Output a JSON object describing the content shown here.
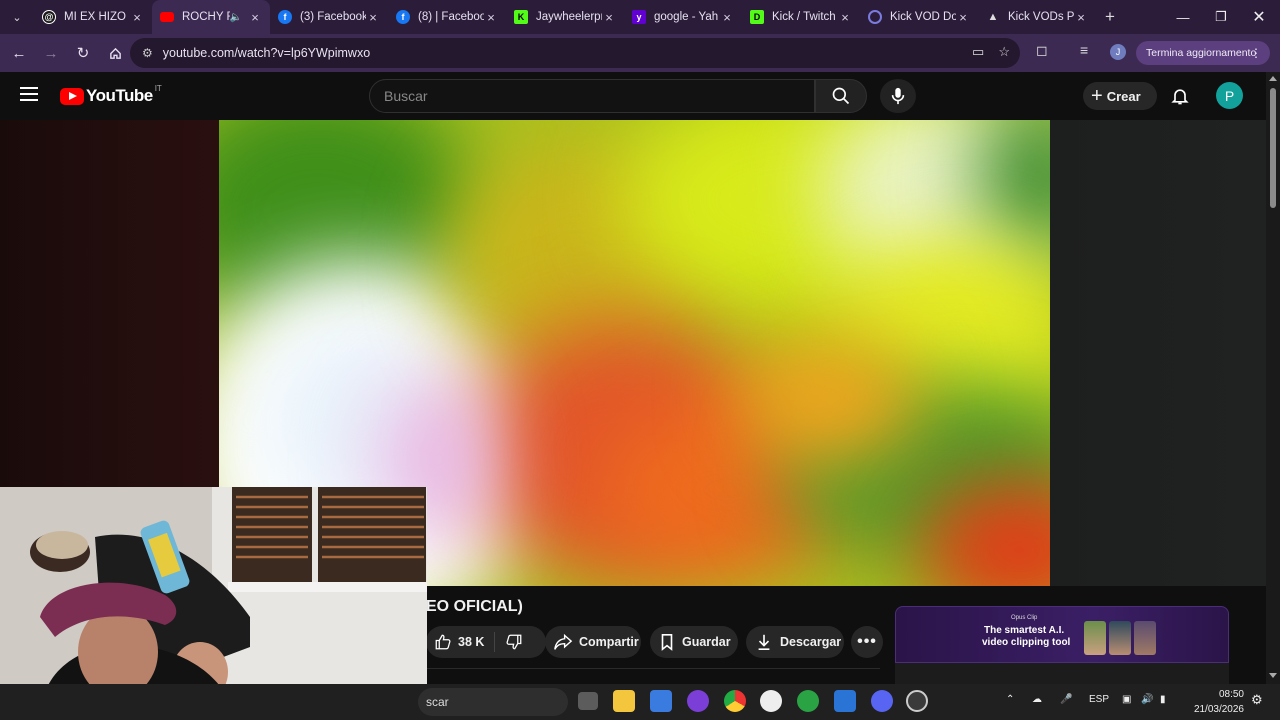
{
  "browser": {
    "tabs": [
      {
        "title": "MI EX HIZO",
        "icon": "threads-icon",
        "color": "#ffffff",
        "active": false
      },
      {
        "title": "ROCHY R",
        "icon": "youtube-icon",
        "color": "#ff0000",
        "active": true,
        "audio": true
      },
      {
        "title": "(3) Facebook",
        "icon": "facebook-icon",
        "color": "#1877f2",
        "active": false
      },
      {
        "title": "(8) | Faceboo",
        "icon": "facebook-icon",
        "color": "#1877f2",
        "active": false
      },
      {
        "title": "Jaywheelerpr",
        "icon": "kick-icon",
        "color": "#53fc18",
        "active": false
      },
      {
        "title": "google - Yah",
        "icon": "yahoo-icon",
        "color": "#6001d2",
        "active": false
      },
      {
        "title": "Kick / Twitch",
        "icon": "kick-twitch-icon",
        "color": "#53fc18",
        "active": false
      },
      {
        "title": "Kick VOD Do",
        "icon": "vod-icon",
        "color": "#6b6bd6",
        "active": false
      },
      {
        "title": "Kick VODs Pl",
        "icon": "kick-vods-icon",
        "color": "#dddddd",
        "active": false
      }
    ],
    "url": "youtube.com/watch?v=lp6YWpimwxo",
    "profile_initial": "J",
    "update_label": "Termina aggiornamento"
  },
  "youtube": {
    "logo_text": "YouTube",
    "logo_sup": "IT",
    "search_placeholder": "Buscar",
    "create_label": "Crear",
    "avatar_initial": "P"
  },
  "video": {
    "title_partial": "EO OFICIAL)",
    "likes": "38 K",
    "share_label": "Compartir",
    "save_label": "Guardar",
    "download_label": "Descargar"
  },
  "ad": {
    "brand": "Opus Clip",
    "headline_1": "The smartest A.I.",
    "headline_2": "video clipping tool"
  },
  "taskbar": {
    "search_text": "scar",
    "language": "ESP",
    "time": "08:50",
    "date": "21/03/2026"
  },
  "colors": {
    "chrome_tabbar": "#2b1d3a",
    "chrome_toolbar": "#3c2a52",
    "youtube_red": "#ff0000",
    "yt_background": "#0f0f0f",
    "avatar_teal": "#12a19b"
  }
}
